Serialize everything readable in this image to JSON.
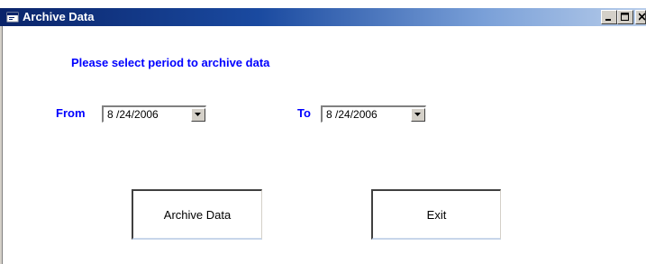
{
  "window": {
    "title": "Archive Data"
  },
  "form": {
    "prompt": "Please select period to archive data",
    "from_label": "From",
    "from_value": "8 /24/2006",
    "to_label": "To",
    "to_value": "8 /24/2006"
  },
  "buttons": {
    "archive_label": "Archive Data",
    "exit_label": "Exit"
  },
  "icons": {
    "app": "window-app-icon",
    "minimize": "minimize-icon",
    "maximize": "maximize-icon",
    "close": "close-icon",
    "dropdown": "chevron-down-icon"
  },
  "colors": {
    "title_start": "#0a246a",
    "title_end": "#b8cdea",
    "label_text": "#0000ff"
  }
}
